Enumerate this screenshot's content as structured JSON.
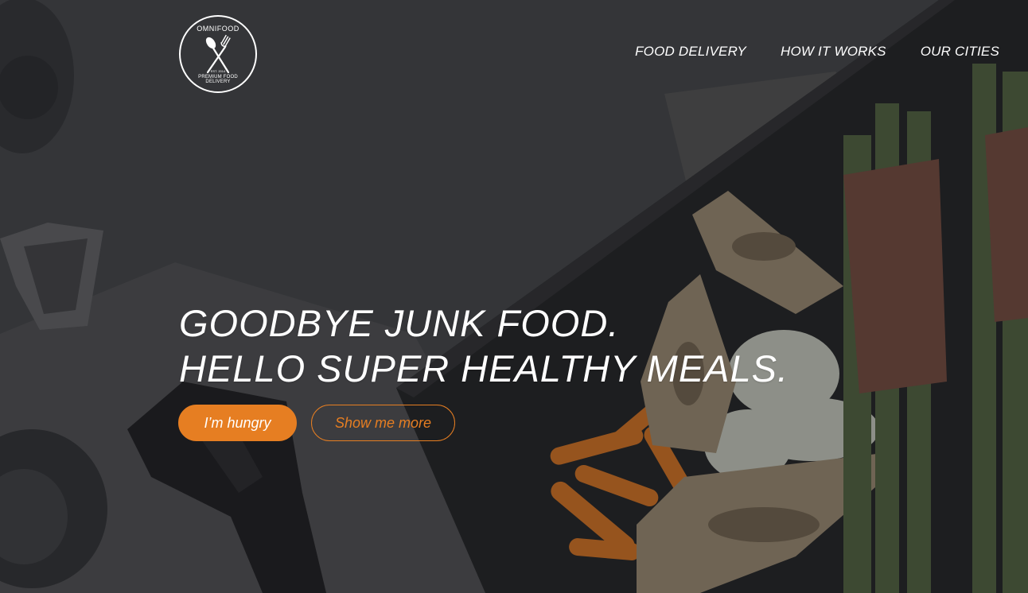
{
  "brand": {
    "name": "OMNIFOOD",
    "est": "EST. 2014",
    "tagline": "PREMIUM FOOD DELIVERY"
  },
  "nav": {
    "items": [
      {
        "label": "FOOD DELIVERY"
      },
      {
        "label": "HOW IT WORKS"
      },
      {
        "label": "OUR CITIES"
      }
    ]
  },
  "hero": {
    "headline_line1": "GOODBYE JUNK FOOD.",
    "headline_line2": "HELLO SUPER HEALTHY MEALS.",
    "primary_button": "I’m hungry",
    "secondary_button": "Show me more"
  },
  "colors": {
    "accent": "#e67e22",
    "overlay": "#3f4144",
    "text": "#ffffff"
  },
  "icons": {
    "logo": "spoon-fork-crossed-icon"
  }
}
